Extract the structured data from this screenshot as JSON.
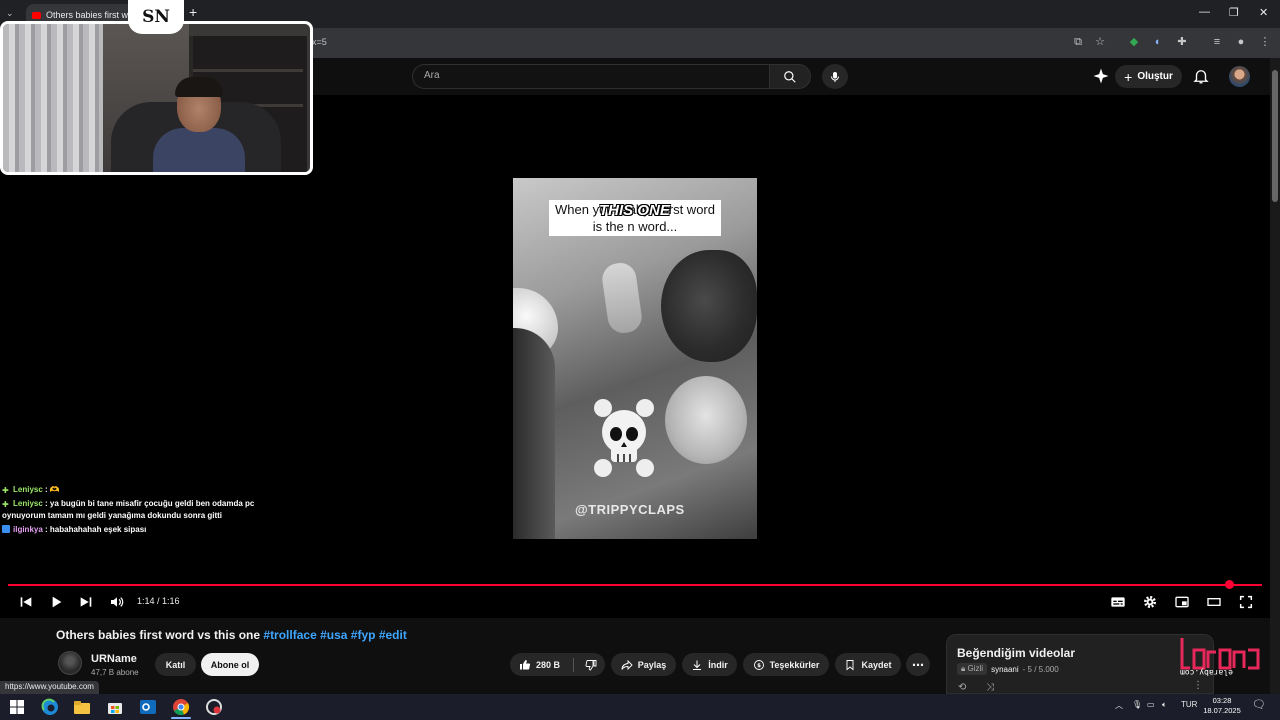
{
  "browser": {
    "tab_title": "Others babies first word vs this one #trollface #usa #fyp #edit - YouTube",
    "address_fragment": "x=5",
    "new_tab_symbol": "+",
    "window_controls": [
      "—",
      "❐",
      "✕"
    ]
  },
  "youtube": {
    "search_placeholder": "Ara",
    "create_label": "Oluştur"
  },
  "video": {
    "caption": "When your baby's first word is the n word...",
    "sticker_text": "THIS ONE",
    "watermark": "@TRIPPYCLAPS",
    "time_display": "1:14 / 1:16",
    "progress": 0.9737,
    "title_text": "Others babies first word vs this one ",
    "hashtags": [
      "#trollface",
      "#usa",
      "#fyp",
      "#edit"
    ]
  },
  "channel": {
    "name": "URName",
    "subscribers": "47,7 B abone",
    "join_label": "Katıl",
    "subscribe_label": "Abone ol"
  },
  "actions": {
    "likes": "280 B",
    "share": "Paylaş",
    "download": "İndir",
    "thanks": "Teşekkürler",
    "save": "Kaydet"
  },
  "playlist": {
    "title": "Beğendiğim videolar",
    "privacy": "Gizli",
    "owner": "synaani",
    "position": "- 5 / 5.000"
  },
  "overlay": {
    "logo_text": "elaraby.com",
    "cam_logo": "SN",
    "chat": [
      {
        "user": "Leniysc",
        "message": " : 🫶"
      },
      {
        "user": "Leniysc",
        "message": " : ya bugün bi tane misafir çocuğu geldi ben odamda pc oynuyorum tamam mı geldi yanağıma dokundu sonra gitti"
      },
      {
        "user": "ilginkya",
        "message": " : habahahahah eşek sipası"
      }
    ]
  },
  "status_url": "https://www.youtube.com",
  "taskbar": {
    "language": "TUR",
    "time": "03:28",
    "date": "18.07.2025"
  },
  "colors": {
    "accent_red": "#ff0033",
    "link_blue": "#3ea6ff",
    "yt_bg": "#0f0f0f"
  }
}
